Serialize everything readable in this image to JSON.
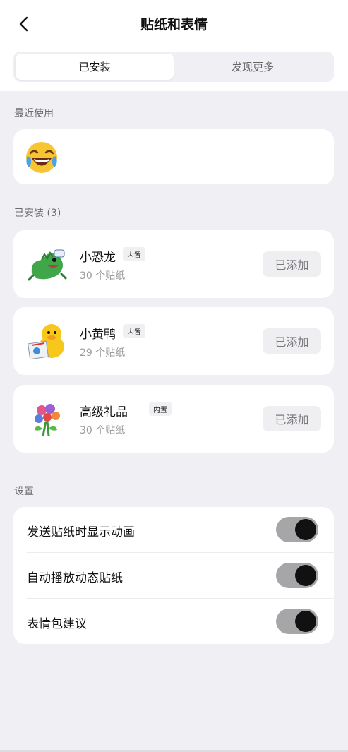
{
  "header": {
    "title": "贴纸和表情",
    "back_icon": "chevron-left-icon"
  },
  "tabs": [
    {
      "label": "已安装",
      "active": true
    },
    {
      "label": "发现更多",
      "active": false
    }
  ],
  "recent": {
    "label": "最近使用",
    "items": [
      "face-with-tears-of-joy"
    ]
  },
  "installed": {
    "label": "已安装 (3)",
    "packs": [
      {
        "name": "小恐龙",
        "badge": "内置",
        "count": "30 个贴纸",
        "button": "已添加",
        "icon": "dinosaur-sticker-icon"
      },
      {
        "name": "小黄鸭",
        "badge": "内置",
        "count": "29 个贴纸",
        "button": "已添加",
        "icon": "duck-sticker-icon"
      },
      {
        "name": "高级礼品",
        "badge": "内置",
        "count": "30 个贴纸",
        "button": "已添加",
        "icon": "flower-bouquet-sticker-icon"
      }
    ]
  },
  "settings": {
    "label": "设置",
    "items": [
      {
        "label": "发送贴纸时显示动画",
        "on": true
      },
      {
        "label": "自动播放动态贴纸",
        "on": true
      },
      {
        "label": "表情包建议",
        "on": true
      }
    ]
  },
  "colors": {
    "background": "#efeff4",
    "card": "#ffffff",
    "toggle_track": "#a6a6a9",
    "toggle_knob": "#111111"
  }
}
